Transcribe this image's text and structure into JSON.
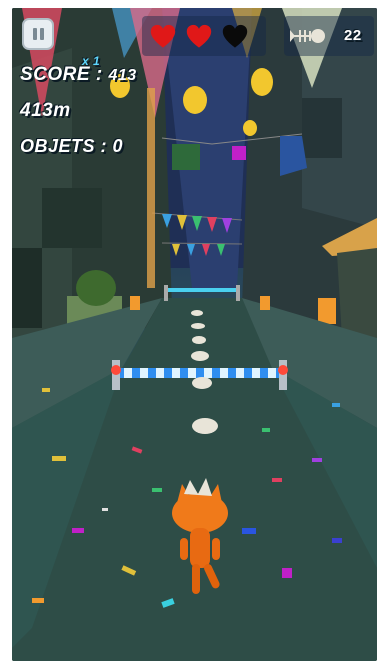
{
  "hud": {
    "pause_label": "II",
    "score_label": "SCORE : ",
    "score_value": "413",
    "multiplier": "x 1",
    "distance": "413m",
    "objects_label": "OBJETS : ",
    "objects_value": "0",
    "fishbone_count": "22",
    "lives": {
      "full": 2,
      "total": 3
    }
  },
  "colors": {
    "heart_full": "#e01818",
    "heart_empty": "#0a0a0a",
    "cat": "#f07a1a",
    "multiplier": "#5fd8ff",
    "road": "#2c4c45",
    "sky": "#1b2a4a"
  },
  "icons": [
    "pause-icon",
    "heart-icon",
    "fishbone-icon",
    "cat-player",
    "fish-skeleton-pickup",
    "barrier"
  ]
}
